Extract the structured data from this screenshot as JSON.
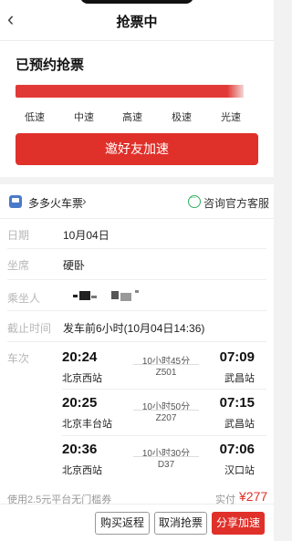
{
  "header": {
    "title": "抢票中"
  },
  "progress": {
    "title": "已预约抢票",
    "fill_fraction": 1.0,
    "speeds": [
      "低速",
      "中速",
      "高速",
      "极速",
      "光速"
    ],
    "invite_label": "邀好友加速"
  },
  "order": {
    "app_name": "多多火车票",
    "support_label": "咨询官方客服",
    "fields": {
      "date_label": "日期",
      "date_value": "10月04日",
      "seat_label": "坐席",
      "seat_value": "硬卧",
      "passenger_label": "乘坐人",
      "deadline_label": "截止时间",
      "deadline_value": "发车前6小时(10月04日14:36)",
      "trains_label": "车次"
    },
    "trains": [
      {
        "dep": "20:24",
        "from": "北京西站",
        "duration": "10小时45分",
        "no": "Z501",
        "arr": "07:09",
        "to": "武昌站"
      },
      {
        "dep": "20:25",
        "from": "北京丰台站",
        "duration": "10小时50分",
        "no": "Z207",
        "arr": "07:15",
        "to": "武昌站"
      },
      {
        "dep": "20:36",
        "from": "北京西站",
        "duration": "10小时30分",
        "no": "D37",
        "arr": "07:06",
        "to": "汉口站"
      }
    ]
  },
  "footer": {
    "coupon_text": "使用2.5元平台无门槛券",
    "pay_label": "实付",
    "pay_value": "¥277",
    "buttons": {
      "return": "购买返程",
      "cancel": "取消抢票",
      "share": "分享加速"
    }
  },
  "colors": {
    "accent": "#e0302a",
    "support_icon": "#2fae5c",
    "app_icon": "#4a79c9"
  }
}
